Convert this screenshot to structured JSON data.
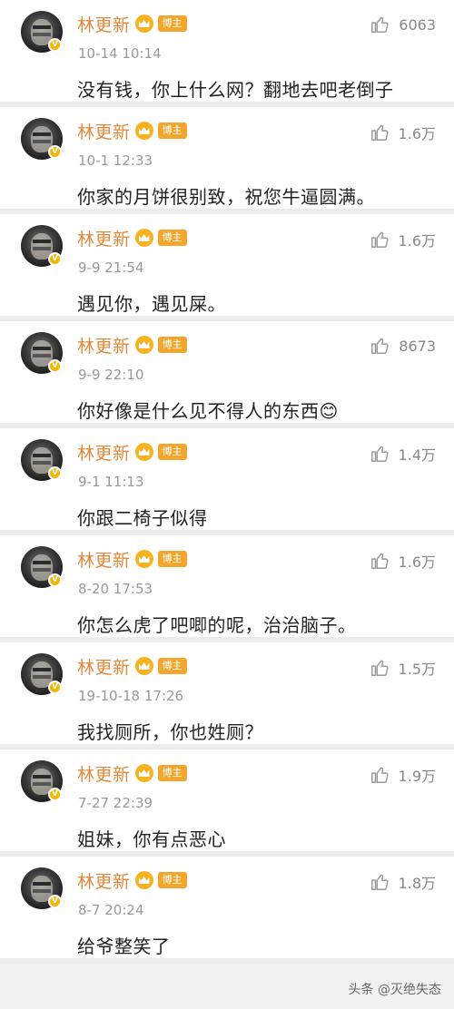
{
  "comments": [
    {
      "name": "林更新",
      "badge": "博主",
      "time": "10-14 10:14",
      "text": "没有钱，你上什么网？翻地去吧老倒子",
      "likes": "6063"
    },
    {
      "name": "林更新",
      "badge": "博主",
      "time": "10-1 12:33",
      "text": "你家的月饼很别致，祝您牛逼圆满。",
      "likes": "1.6万"
    },
    {
      "name": "林更新",
      "badge": "博主",
      "time": "9-9 21:54",
      "text": "遇见你，遇见屎。",
      "likes": "1.6万"
    },
    {
      "name": "林更新",
      "badge": "博主",
      "time": "9-9 22:10",
      "text": "你好像是什么见不得人的东西😊",
      "likes": "8673"
    },
    {
      "name": "林更新",
      "badge": "博主",
      "time": "9-1 11:13",
      "text": "你跟二椅子似得",
      "likes": "1.4万"
    },
    {
      "name": "林更新",
      "badge": "博主",
      "time": "8-20 17:53",
      "text": "你怎么虎了吧唧的呢，治治脑子。",
      "likes": "1.6万"
    },
    {
      "name": "林更新",
      "badge": "博主",
      "time": "19-10-18 17:26",
      "text": "我找厕所，你也姓厕？",
      "likes": "1.5万"
    },
    {
      "name": "林更新",
      "badge": "博主",
      "time": "7-27 22:39",
      "text": "姐妹，你有点恶心",
      "likes": "1.9万"
    },
    {
      "name": "林更新",
      "badge": "博主",
      "time": "8-7 20:24",
      "text": "给爷整笑了",
      "likes": "1.8万"
    }
  ],
  "icons": {
    "like": "thumbs-up-icon",
    "crown": "crown-icon",
    "verified": "verified-v-icon"
  },
  "colors": {
    "name": "#e2883a",
    "tag": "#f3a62d",
    "crown": "#f6b31f",
    "like": "#888888"
  },
  "watermark": "头条 @灭绝失态"
}
